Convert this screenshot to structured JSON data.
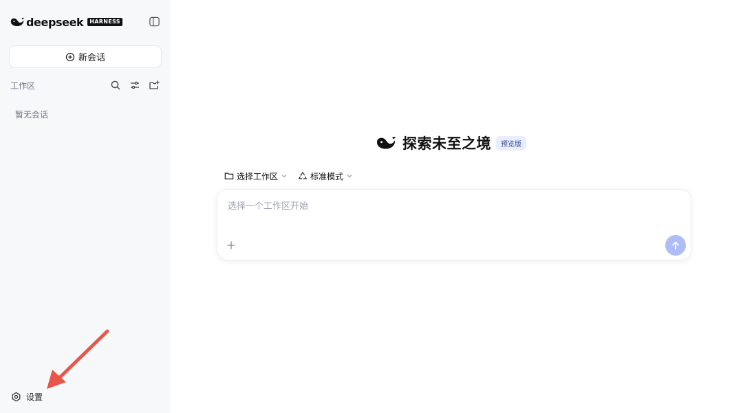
{
  "brand": {
    "wordmark": "deepseek",
    "badge": "HARNESS"
  },
  "sidebar": {
    "new_chat_label": "新会话",
    "workspace_label": "工作区",
    "empty_text": "暂无会话",
    "settings_label": "设置"
  },
  "main": {
    "title": "探索未至之境",
    "badge": "预览版",
    "workspace_selector": "选择工作区",
    "mode_selector": "标准模式",
    "input_placeholder": "选择一个工作区开始"
  },
  "colors": {
    "accent": "#aebdf6",
    "annotation_arrow": "#e8564a",
    "badge_bg": "#e8eeff"
  },
  "icons": [
    "deepseek-whale-icon",
    "sidebar-toggle-icon",
    "plus-circle-icon",
    "search-icon",
    "sliders-icon",
    "folder-plus-icon",
    "gear-icon",
    "folder-icon",
    "chevron-down-icon",
    "recycle-icon",
    "plus-icon",
    "arrow-up-icon"
  ]
}
